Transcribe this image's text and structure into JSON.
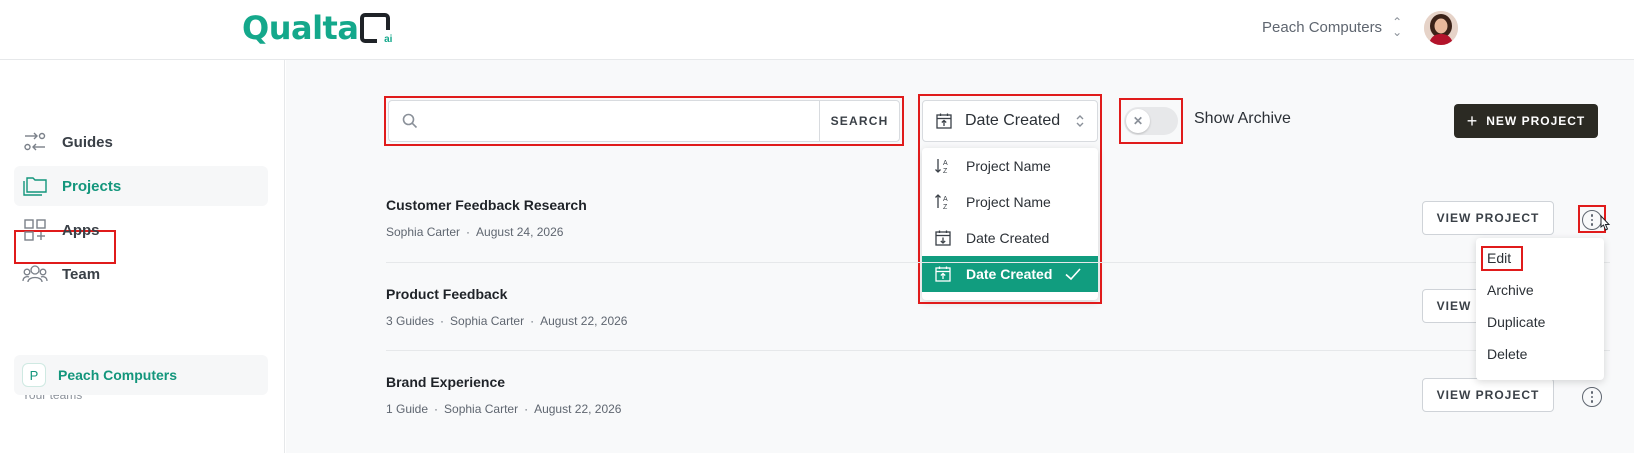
{
  "brand": {
    "name": "Qualta",
    "suffix": "ai",
    "accent": "#14a88b"
  },
  "header": {
    "org_name": "Peach Computers"
  },
  "sidebar": {
    "items": [
      {
        "label": "Guides",
        "icon": "guides-icon"
      },
      {
        "label": "Projects",
        "icon": "folder-icon",
        "active": true
      },
      {
        "label": "Apps",
        "icon": "apps-icon"
      },
      {
        "label": "Team",
        "icon": "team-icon"
      }
    ],
    "teams_heading": "Your teams",
    "teams": [
      {
        "badge": "P",
        "label": "Peach Computers"
      }
    ]
  },
  "toolbar": {
    "search_placeholder": "",
    "search_button": "SEARCH",
    "sort_selected": "Date Created",
    "sort_options": [
      {
        "label": "Project Name",
        "icon": "sort-az-down-icon"
      },
      {
        "label": "Project Name",
        "icon": "sort-az-up-icon"
      },
      {
        "label": "Date Created",
        "icon": "calendar-down-icon"
      },
      {
        "label": "Date Created",
        "icon": "calendar-up-icon",
        "selected": true
      }
    ],
    "archive_label": "Show Archive",
    "archive_on": false,
    "new_project_label": "NEW PROJECT"
  },
  "projects": [
    {
      "title": "Customer Feedback Research",
      "meta": [
        "Sophia Carter",
        "August 24, 2026"
      ],
      "view_label": "VIEW PROJECT"
    },
    {
      "title": "Product Feedback",
      "meta": [
        "3 Guides",
        "Sophia Carter",
        "August 22, 2026"
      ],
      "view_label": "VIEW PROJECT"
    },
    {
      "title": "Brand Experience",
      "meta": [
        "1 Guide",
        "Sophia Carter",
        "August 22, 2026"
      ],
      "view_label": "VIEW PROJECT"
    }
  ],
  "context_menu": {
    "items": [
      "Edit",
      "Archive",
      "Duplicate",
      "Delete"
    ]
  }
}
